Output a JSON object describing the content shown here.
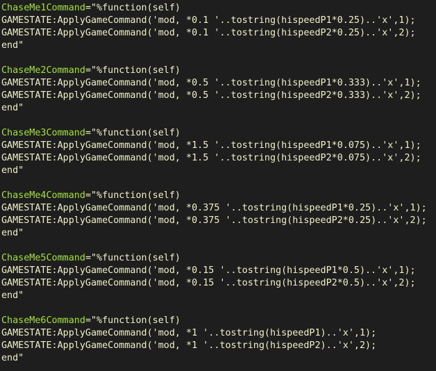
{
  "theme": {
    "background": "#1e1e1e",
    "text_color": "#f0f0c8",
    "command_name_color": "#a6e22e"
  },
  "blocks": [
    {
      "name": "ChaseMe1Command",
      "rest": "=\"%function(self)",
      "line2": "GAMESTATE:ApplyGameCommand('mod, *0.1 '..tostring(hispeedP1*0.25)..'x',1);",
      "line3": "GAMESTATE:ApplyGameCommand('mod, *0.1 '..tostring(hispeedP2*0.25)..'x',2);",
      "line4": "end\""
    },
    {
      "name": "ChaseMe2Command",
      "rest": "=\"%function(self)",
      "line2": "GAMESTATE:ApplyGameCommand('mod, *0.5 '..tostring(hispeedP1*0.333)..'x',1);",
      "line3": "GAMESTATE:ApplyGameCommand('mod, *0.5 '..tostring(hispeedP2*0.333)..'x',2);",
      "line4": "end\""
    },
    {
      "name": "ChaseMe3Command",
      "rest": "=\"%function(self)",
      "line2": "GAMESTATE:ApplyGameCommand('mod, *1.5 '..tostring(hispeedP1*0.075)..'x',1);",
      "line3": "GAMESTATE:ApplyGameCommand('mod, *1.5 '..tostring(hispeedP2*0.075)..'x',2);",
      "line4": "end\""
    },
    {
      "name": "ChaseMe4Command",
      "rest": "=\"%function(self)",
      "line2": "GAMESTATE:ApplyGameCommand('mod, *0.375 '..tostring(hispeedP1*0.25)..'x',1);",
      "line3": "GAMESTATE:ApplyGameCommand('mod, *0.375 '..tostring(hispeedP2*0.25)..'x',2);",
      "line4": "end\""
    },
    {
      "name": "ChaseMe5Command",
      "rest": "=\"%function(self)",
      "line2": "GAMESTATE:ApplyGameCommand('mod, *0.15 '..tostring(hispeedP1*0.5)..'x',1);",
      "line3": "GAMESTATE:ApplyGameCommand('mod, *0.15 '..tostring(hispeedP2*0.5)..'x',2);",
      "line4": "end\""
    },
    {
      "name": "ChaseMe6Command",
      "rest": "=\"%function(self)",
      "line2": "GAMESTATE:ApplyGameCommand('mod, *1 '..tostring(hispeedP1)..'x',1);",
      "line3": "GAMESTATE:ApplyGameCommand('mod, *1 '..tostring(hispeedP2)..'x',2);",
      "line4": "end\""
    }
  ]
}
